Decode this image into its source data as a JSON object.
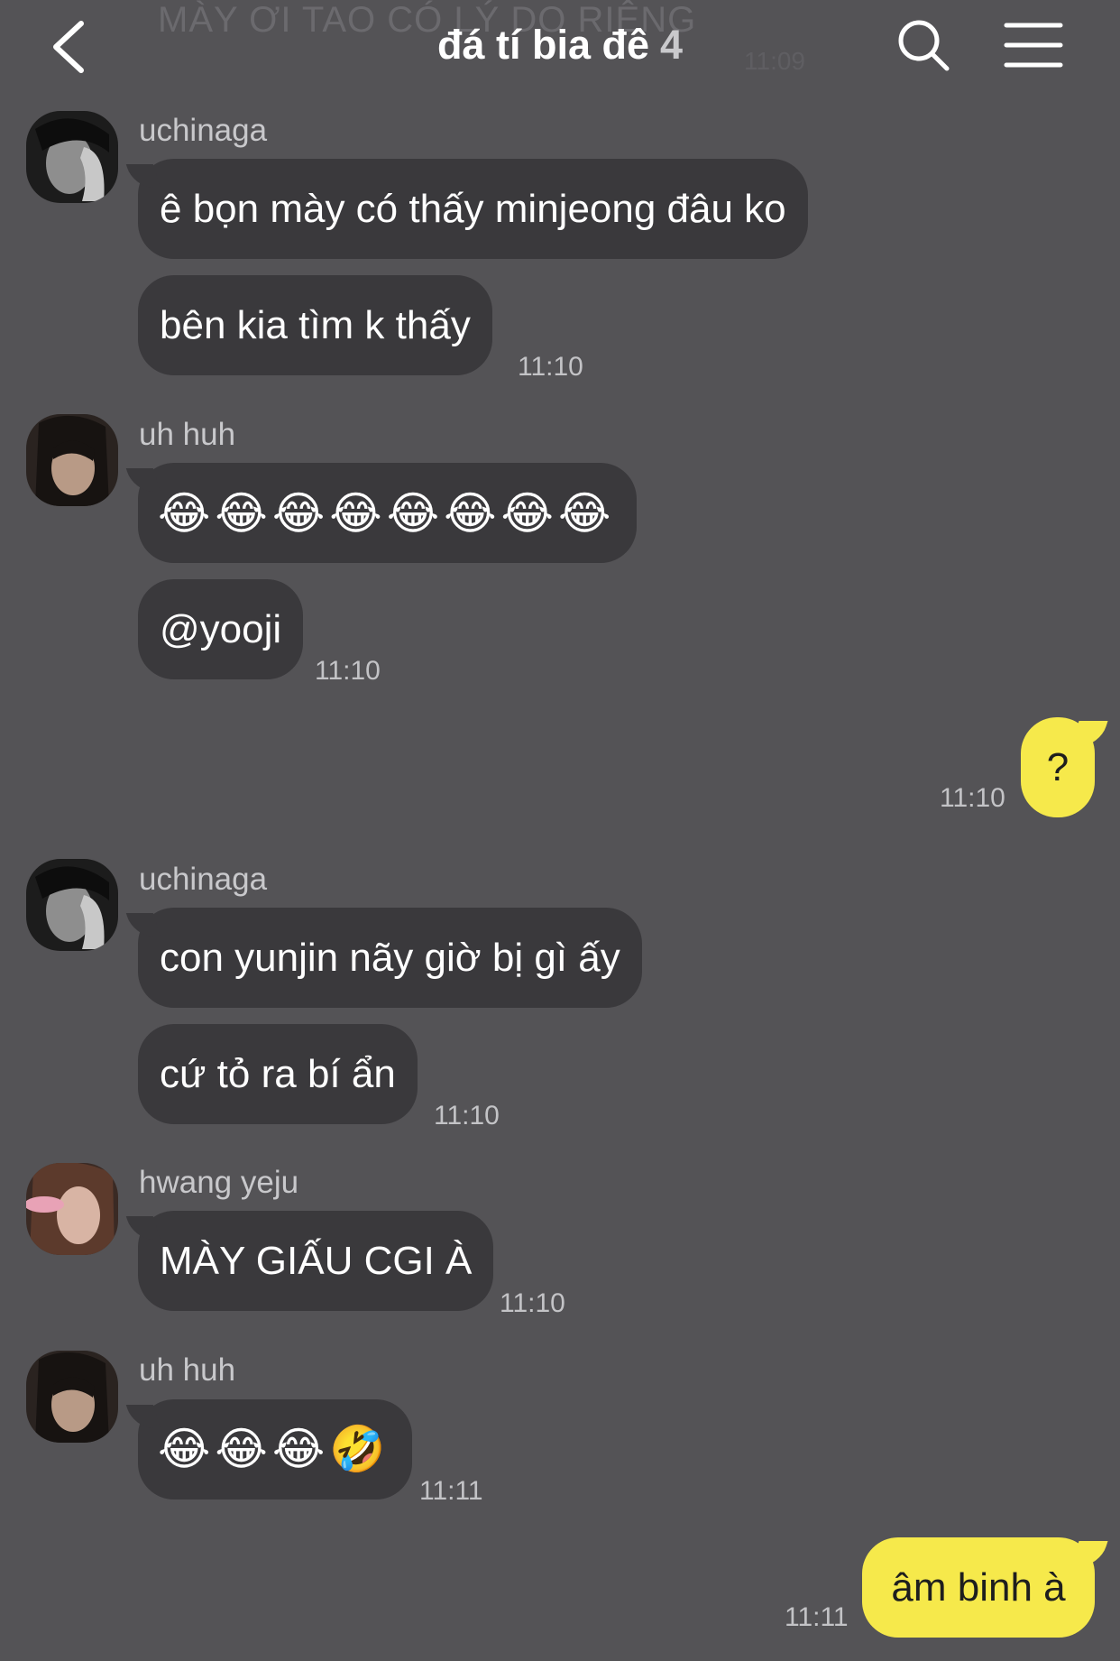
{
  "header": {
    "title": "đá tí bia đê",
    "member_count": "4",
    "ghost_text": "MÀY ƠI TAO CÓ LÝ DO RIÊNG",
    "ghost_time": "11:09",
    "back_icon": "chevron-left-icon",
    "search_icon": "search-icon",
    "menu_icon": "hamburger-menu-icon"
  },
  "colors": {
    "background": "#545356",
    "incoming_bubble": "#3a393c",
    "outgoing_bubble": "#f6e94b",
    "timestamp": "#c3c3c6"
  },
  "messages": [
    {
      "sender": "uchinaga",
      "bubbles": [
        "ê bọn mày có thấy minjeong đâu ko",
        "bên kia tìm k thấy"
      ],
      "time": "11:10"
    },
    {
      "sender": "uh huh",
      "bubbles": [
        "😂😂😂😂😂😂😂😂",
        "@yooji"
      ],
      "time": "11:10"
    },
    {
      "sender": "me",
      "bubbles": [
        "?"
      ],
      "time": "11:10"
    },
    {
      "sender": "uchinaga",
      "bubbles": [
        "con yunjin nãy giờ bị gì ấy",
        "cứ tỏ ra bí ẩn"
      ],
      "time": "11:10"
    },
    {
      "sender": "hwang yeju",
      "bubbles": [
        "MÀY GIẤU CGI À"
      ],
      "time": "11:10"
    },
    {
      "sender": "uh huh",
      "bubbles": [
        "😂😂😂🤣"
      ],
      "time": "11:11"
    },
    {
      "sender": "me",
      "bubbles": [
        "âm binh à"
      ],
      "time": "11:11"
    }
  ]
}
